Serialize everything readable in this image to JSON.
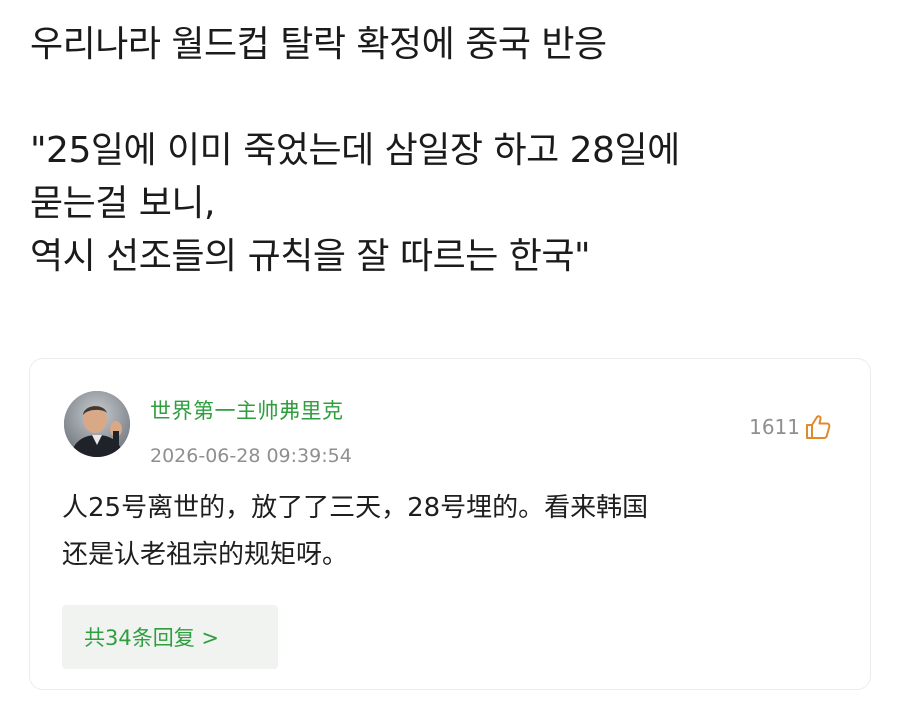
{
  "post": {
    "lines": [
      "우리나라 월드컵 탈락 확정에 중국 반응",
      "",
      "\"25일에 이미 죽었는데 삼일장 하고 28일에",
      "묻는걸 보니,",
      "역시 선조들의 규칙을 잘 따르는 한국\""
    ]
  },
  "comment": {
    "username": "世界第一主帅弗里克",
    "timestamp": "2026-06-28 09:39:54",
    "likes": "1611",
    "like_icon": "thumbs-up-icon",
    "body_lines": [
      "人25号离世的，放了了三天，28号埋的。看来韩国",
      "还是认老祖宗的规矩呀。"
    ],
    "replies_label": "共34条回复 >"
  },
  "colors": {
    "username": "#2f9e3f",
    "meta_gray": "#8f8f8f",
    "like_icon": "#e08a2c"
  }
}
